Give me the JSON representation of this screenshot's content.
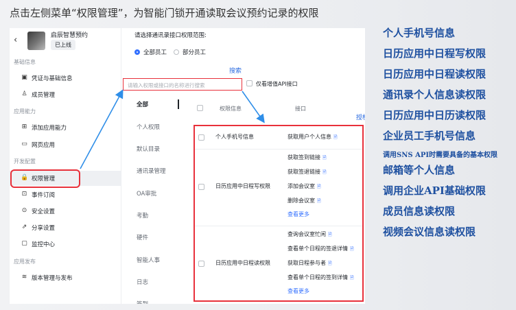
{
  "heading": "点击左侧菜单“权限管理”，为智能门锁开通读取会议预约记录的权限",
  "app": {
    "back_icon": "‹",
    "name": "启辰智慧预约",
    "status": "已上线"
  },
  "sidebar": {
    "sections": [
      "基础信息",
      "应用能力",
      "开发配置",
      "应用发布"
    ],
    "items": [
      {
        "label": "凭证与基础信息",
        "icon": "▣"
      },
      {
        "label": "成员管理",
        "icon": "♙"
      },
      {
        "label": "添加应用能力",
        "icon": "⊞"
      },
      {
        "label": "网页应用",
        "icon": "▭"
      },
      {
        "label": "权限管理",
        "icon": "🔒"
      },
      {
        "label": "事件订阅",
        "icon": "⊡"
      },
      {
        "label": "安全设置",
        "icon": "⊙"
      },
      {
        "label": "分享设置",
        "icon": "⇗"
      },
      {
        "label": "监控中心",
        "icon": "▢"
      },
      {
        "label": "版本管理与发布",
        "icon": "≋"
      }
    ]
  },
  "main": {
    "scope_label": "请选择通讯录接口权限范围:",
    "radio_all": "全部员工",
    "radio_part": "部分员工",
    "search_placeholder": "请输入权限或接口的名称进行搜索",
    "addon_label": "仅看增值API接口",
    "annotations": {
      "search": "搜索",
      "grant": "授权"
    },
    "categories": [
      "全部",
      "个人权限",
      "默认目录",
      "通讯录管理",
      "OA审批",
      "考勤",
      "硬件",
      "智能人事",
      "日志",
      "签到"
    ],
    "table_headers": {
      "permission": "权限信息",
      "api": "接口"
    },
    "rows": [
      {
        "permission": "个人手机号信息",
        "apis": [
          "获取用户个人信息"
        ],
        "more": ""
      },
      {
        "permission": "日历应用中日程写权限",
        "apis": [
          "获取签到链接",
          "获取签退链接",
          "添加会议室",
          "删除会议室"
        ],
        "more": "查看更多"
      },
      {
        "permission": "日历应用中日程读权限",
        "apis": [
          "查询会议室忙闲",
          "查看单个日程的签退详情",
          "获取日程参与者",
          "查看单个日程的签到详情"
        ],
        "more": "查看更多"
      }
    ]
  },
  "right_list": [
    "个人手机号信息",
    "日历应用中日程写权限",
    "日历应用中日程读权限",
    "通讯录个人信息读权限",
    "日历应用中日历读权限",
    "企业员工手机号信息",
    "调用SNS API时需要具备的基本权限",
    "邮箱等个人信息",
    "调用企业API基础权限",
    "成员信息读权限",
    "视频会议信息读权限"
  ],
  "colors": {
    "highlight": "#e8303a",
    "accent": "#3370ff",
    "right_text": "#1e50a0",
    "arrow": "#2f8ee8"
  }
}
